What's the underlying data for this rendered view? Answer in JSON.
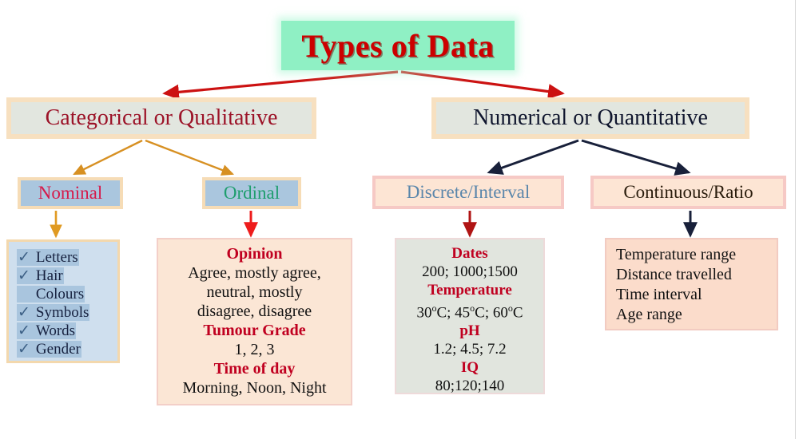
{
  "title": {
    "text": "Types of Data",
    "bg_color": "#8ff0c4",
    "text_color": "#cc0000"
  },
  "level2": {
    "categorical": {
      "label": "Categorical or Qualitative",
      "text_color": "#9c1328",
      "bg_color": "#e2e6df"
    },
    "numerical": {
      "label": "Numerical or Quantitative",
      "text_color": "#10162e",
      "bg_color": "#e2e6df"
    }
  },
  "level3": {
    "nominal": {
      "label": "Nominal",
      "text_color": "#d6194a",
      "bg_color": "#aac6de"
    },
    "ordinal": {
      "label": "Ordinal",
      "text_color": "#1f9e6e",
      "bg_color": "#aac6de"
    },
    "discrete": {
      "label": "Discrete/Interval",
      "text_color": "#5a86ab",
      "bg_color": "#fde5d4"
    },
    "continuous": {
      "label": "Continuous/Ratio",
      "text_color": "#2a1c0c",
      "bg_color": "#fde5d4"
    }
  },
  "leaves": {
    "nominal": {
      "bg_color": "#cfdfee",
      "tick_glyph": "✓",
      "items": [
        {
          "text": "Letters",
          "ticked": true,
          "continuation": false
        },
        {
          "text": "Hair",
          "ticked": true,
          "continuation": false
        },
        {
          "text": "Colours",
          "ticked": false,
          "continuation": true
        },
        {
          "text": "Symbols",
          "ticked": true,
          "continuation": false
        },
        {
          "text": "Words",
          "ticked": true,
          "continuation": false
        },
        {
          "text": "Gender",
          "ticked": true,
          "continuation": false
        }
      ]
    },
    "ordinal": {
      "bg_color": "#fbe6d5",
      "entries": [
        {
          "header": "Opinion",
          "lines": [
            "Agree, mostly agree,",
            "neutral, mostly",
            "disagree, disagree"
          ]
        },
        {
          "header": "Tumour Grade",
          "lines": [
            "1, 2, 3"
          ]
        },
        {
          "header": "Time of day",
          "lines": [
            "Morning, Noon, Night"
          ]
        }
      ]
    },
    "discrete": {
      "bg_color": "#e1e5de",
      "entries": [
        {
          "header": "Dates",
          "lines": [
            "200; 1000;1500"
          ]
        },
        {
          "header": "Temperature",
          "lines": [
            "30ºC; 45ºC; 60ºC"
          ]
        },
        {
          "header": "pH",
          "lines": [
            "1.2; 4.5; 7.2"
          ]
        },
        {
          "header": "IQ",
          "lines": [
            "80;120;140"
          ]
        }
      ]
    },
    "continuous": {
      "bg_color": "#fbdccb",
      "lines": [
        "Temperature range",
        "Distance travelled",
        "Time interval",
        "Age range"
      ]
    }
  },
  "connectors": {
    "title_to_level2_color": "#cc1111",
    "categorical_branch_color": "#d79022",
    "numerical_branch_color": "#18203a",
    "nominal_stem_color": "#e09a22",
    "ordinal_stem_color": "#ee1c1c",
    "discrete_stem_color": "#b01414",
    "continuous_stem_color": "#18203a"
  }
}
